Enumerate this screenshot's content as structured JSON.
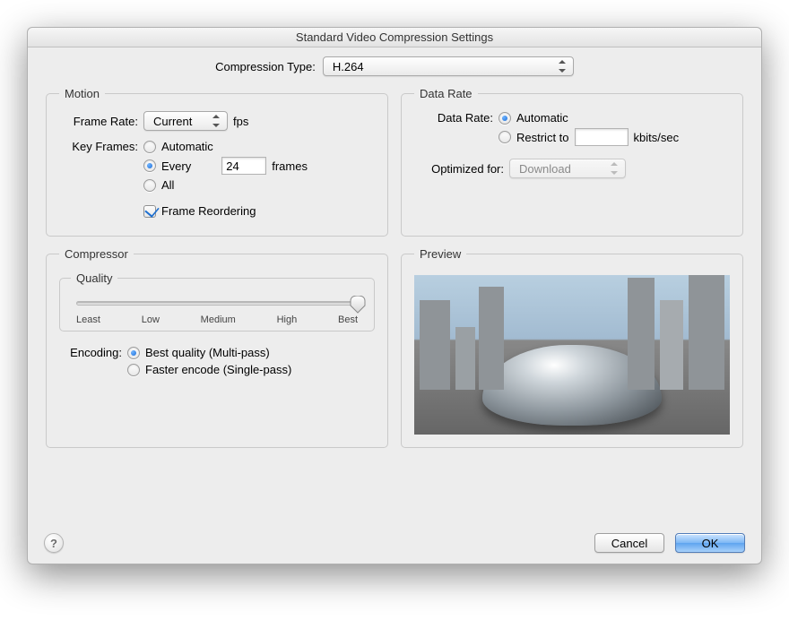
{
  "title": "Standard Video Compression Settings",
  "compressionType": {
    "label": "Compression Type:",
    "value": "H.264"
  },
  "motion": {
    "legend": "Motion",
    "frameRate": {
      "label": "Frame Rate:",
      "value": "Current",
      "unit": "fps"
    },
    "keyFrames": {
      "label": "Key Frames:",
      "options": {
        "automatic": "Automatic",
        "every": "Every",
        "all": "All"
      },
      "everyValue": "24",
      "everyUnit": "frames"
    },
    "frameReordering": "Frame Reordering"
  },
  "dataRate": {
    "legend": "Data Rate",
    "label": "Data Rate:",
    "options": {
      "automatic": "Automatic",
      "restrict": "Restrict to"
    },
    "restrictValue": "",
    "restrictUnit": "kbits/sec",
    "optimized": {
      "label": "Optimized for:",
      "value": "Download"
    }
  },
  "compressor": {
    "legend": "Compressor",
    "quality": {
      "legend": "Quality",
      "ticks": [
        "Least",
        "Low",
        "Medium",
        "High",
        "Best"
      ]
    },
    "encoding": {
      "label": "Encoding:",
      "best": "Best quality (Multi-pass)",
      "faster": "Faster encode (Single-pass)"
    }
  },
  "preview": {
    "legend": "Preview"
  },
  "buttons": {
    "help": "?",
    "cancel": "Cancel",
    "ok": "OK"
  }
}
